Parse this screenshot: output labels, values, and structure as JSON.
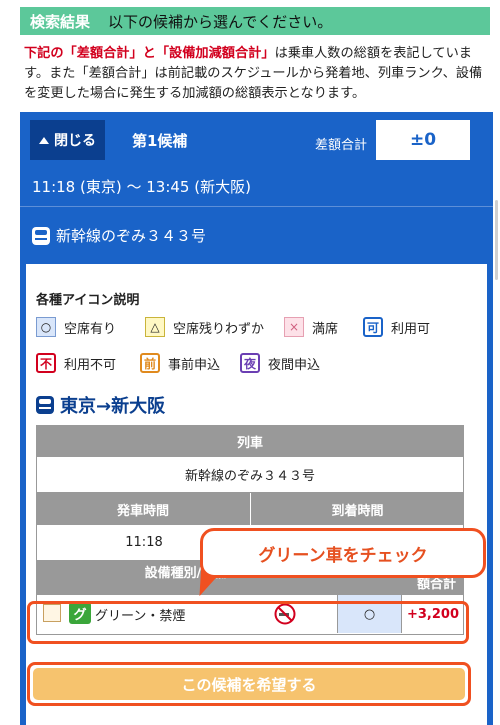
{
  "header": {
    "title": "検索結果",
    "subtitle": "以下の候補から選んでください。"
  },
  "notice": {
    "red1": "下記の「差額合計」と「設備加減額合計」",
    "mid1": "は乗車人数の総額を表記しています。",
    "rest": "また「差額合計」は前記載のスケジュールから発着地、列車ランク、設備を変更した場合に発生する加減額の総額表示となります。"
  },
  "candidate": {
    "close_label": "閉じる",
    "title": "第1候補",
    "diff_label": "差額合計",
    "diff_value": "±0",
    "time": "11:18 (東京) 〜 13:45 (新大阪)",
    "train": "新幹線のぞみ３４３号"
  },
  "legend": {
    "title": "各種アイコン説明",
    "items": [
      {
        "symbol": "○",
        "label": "空席有り"
      },
      {
        "symbol": "△",
        "label": "空席残りわずか"
      },
      {
        "symbol": "×",
        "label": "満席"
      },
      {
        "symbol": "可",
        "label": "利用可"
      },
      {
        "symbol": "不",
        "label": "利用不可"
      },
      {
        "symbol": "前",
        "label": "事前申込"
      },
      {
        "symbol": "夜",
        "label": "夜間申込"
      }
    ]
  },
  "route": {
    "label": "東京→新大阪"
  },
  "table": {
    "train_header": "列車",
    "train_name": "新幹線のぞみ３４３号",
    "depart_header": "発車時間",
    "arrive_header": "到着時間",
    "depart_time": "11:18",
    "facility_header": "設備種別/設備",
    "amount_header": "額合計",
    "row": {
      "badge": "グ",
      "facility": "グリーン・禁煙",
      "availability": "○",
      "amount": "+3,200"
    }
  },
  "callout": "グリーン車をチェック",
  "cta_label": "この候補を希望する",
  "colors": {
    "header_green": "#5cc89a",
    "panel_blue": "#1a63c8",
    "callout_orange": "#f05020",
    "cta_orange": "#f6c36e",
    "price_red": "#d2001e"
  }
}
